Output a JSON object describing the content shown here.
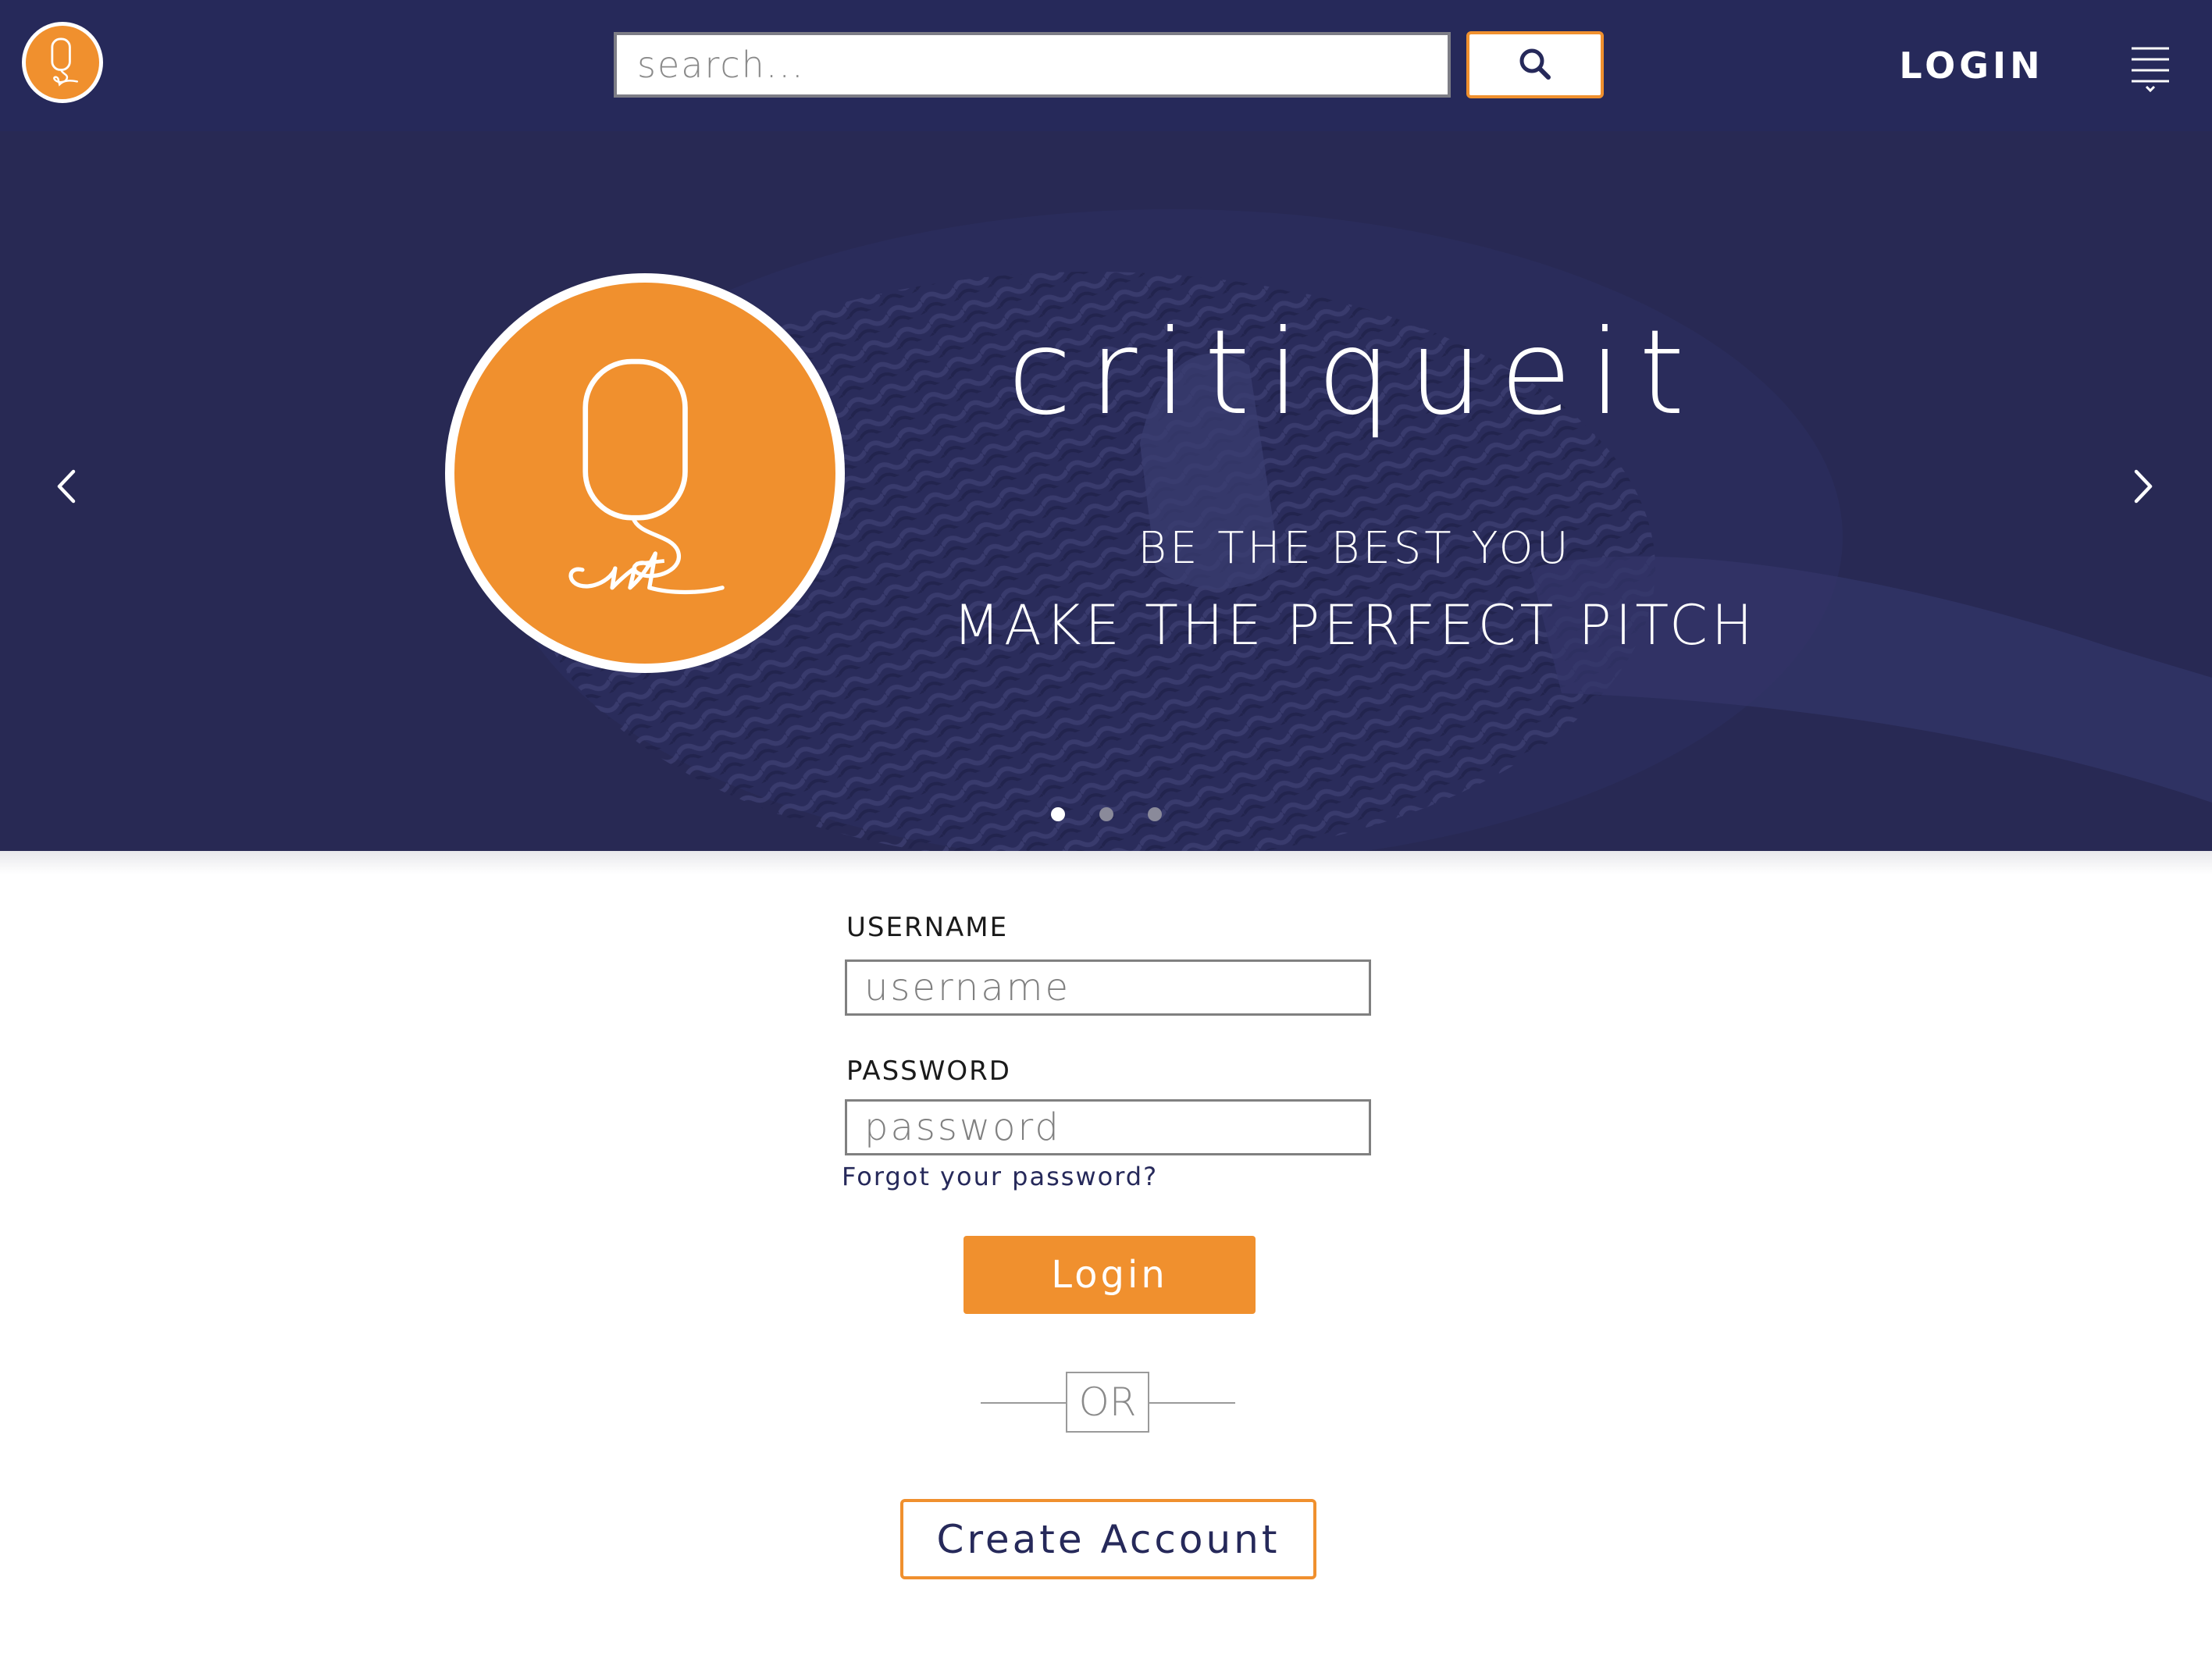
{
  "brand": {
    "name": "critiqueit",
    "logo_text": "Q it",
    "colors": {
      "navy": "#26295a",
      "hero_bg": "#2b2c57",
      "accent_orange": "#f0902e",
      "white": "#ffffff"
    }
  },
  "header": {
    "logo_icon": "critiqueit-logo-icon",
    "search": {
      "placeholder": "search...",
      "value": "",
      "button_icon": "search-icon"
    },
    "login_label": "LOGIN",
    "menu_icon": "hamburger-menu-icon"
  },
  "hero": {
    "title": "critiqueit",
    "tagline_primary": "BE THE BEST YOU",
    "tagline_secondary": "MAKE THE PERFECT PITCH",
    "background_icon": "microphone-icon",
    "prev_icon": "chevron-left-icon",
    "next_icon": "chevron-right-icon",
    "slides_total": 3,
    "active_slide": 1
  },
  "login_form": {
    "username_label": "USERNAME",
    "username_placeholder": "username",
    "username_value": "",
    "password_label": "PASSWORD",
    "password_placeholder": "password",
    "password_value": "",
    "forgot_password_text": "Forgot your password?",
    "login_button_label": "Login",
    "divider_text": "OR",
    "create_account_label": "Create Account"
  }
}
